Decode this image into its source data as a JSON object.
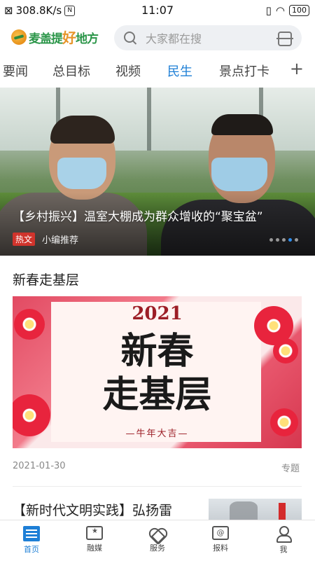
{
  "status_bar": {
    "network_speed": "308.8K/s",
    "nfc": "N",
    "time": "11:07",
    "battery": "100"
  },
  "header": {
    "logo_text_main": "麦盖提",
    "logo_text_accent": "好",
    "logo_text_tail": "地方",
    "search_placeholder": "大家都在搜"
  },
  "tabs": {
    "items": [
      {
        "label": "要闻"
      },
      {
        "label": "总目标"
      },
      {
        "label": "视频"
      },
      {
        "label": "民生"
      },
      {
        "label": "景点打卡"
      }
    ],
    "active": "民生",
    "add_label": "+"
  },
  "hero": {
    "title": "【乡村振兴】温室大棚成为群众增收的“聚宝盆”",
    "tag": "热文",
    "source": "小编推荐",
    "slide_count": 5,
    "active_slide": 4
  },
  "section": {
    "title": "新春走基层",
    "banner": {
      "year": "2021",
      "line1": "新春",
      "line2": "走基层",
      "subtitle": "—牛年大吉—"
    },
    "date": "2021-01-30",
    "type": "专题"
  },
  "article": {
    "title": "【新时代文明实践】弘扬雷"
  },
  "bottom_nav": {
    "items": [
      {
        "label": "首页",
        "icon": "home-icon"
      },
      {
        "label": "融媒",
        "icon": "media-icon"
      },
      {
        "label": "服务",
        "icon": "service-icon"
      },
      {
        "label": "报料",
        "icon": "report-icon"
      },
      {
        "label": "我",
        "icon": "profile-icon"
      }
    ],
    "active": "首页"
  },
  "colors": {
    "accent": "#1e7fd6",
    "hot_tag": "#d0342c",
    "logo_green": "#2a9548"
  }
}
